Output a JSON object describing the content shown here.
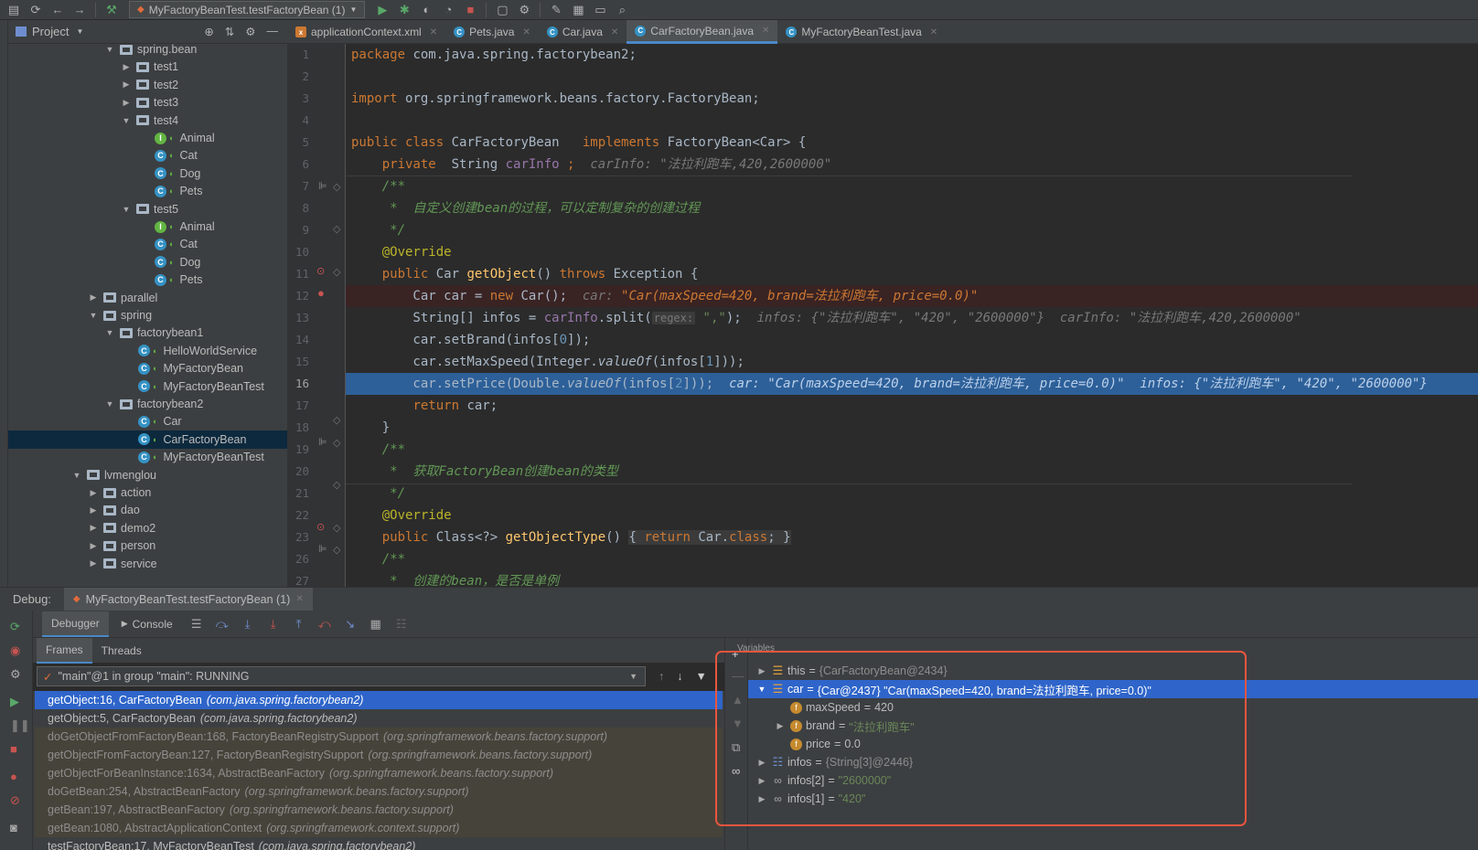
{
  "toolbar": {
    "run_config": "MyFactoryBeanTest.testFactoryBean (1)"
  },
  "project": {
    "title": "Project",
    "tree": [
      {
        "label": "spring.bean",
        "kind": "folder",
        "indent": 6,
        "expanded": true
      },
      {
        "label": "test1",
        "kind": "folder",
        "indent": 7
      },
      {
        "label": "test2",
        "kind": "folder",
        "indent": 7
      },
      {
        "label": "test3",
        "kind": "folder",
        "indent": 7
      },
      {
        "label": "test4",
        "kind": "folder",
        "indent": 7,
        "expanded": true
      },
      {
        "label": "Animal",
        "kind": "interface",
        "indent": 9
      },
      {
        "label": "Cat",
        "kind": "class",
        "indent": 9
      },
      {
        "label": "Dog",
        "kind": "class",
        "indent": 9
      },
      {
        "label": "Pets",
        "kind": "class",
        "indent": 9
      },
      {
        "label": "test5",
        "kind": "folder",
        "indent": 7,
        "expanded": true
      },
      {
        "label": "Animal",
        "kind": "interface",
        "indent": 9
      },
      {
        "label": "Cat",
        "kind": "class",
        "indent": 9
      },
      {
        "label": "Dog",
        "kind": "class",
        "indent": 9
      },
      {
        "label": "Pets",
        "kind": "class",
        "indent": 9
      },
      {
        "label": "parallel",
        "kind": "folder",
        "indent": 5
      },
      {
        "label": "spring",
        "kind": "folder",
        "indent": 5,
        "expanded": true
      },
      {
        "label": "factorybean1",
        "kind": "folder",
        "indent": 6,
        "expanded": true
      },
      {
        "label": "HelloWorldService",
        "kind": "class",
        "indent": 8
      },
      {
        "label": "MyFactoryBean",
        "kind": "class",
        "indent": 8
      },
      {
        "label": "MyFactoryBeanTest",
        "kind": "testclass",
        "indent": 8
      },
      {
        "label": "factorybean2",
        "kind": "folder",
        "indent": 6,
        "expanded": true
      },
      {
        "label": "Car",
        "kind": "class",
        "indent": 8
      },
      {
        "label": "CarFactoryBean",
        "kind": "class",
        "indent": 8,
        "selected": true
      },
      {
        "label": "MyFactoryBeanTest",
        "kind": "testclass",
        "indent": 8
      },
      {
        "label": "lvmenglou",
        "kind": "folder",
        "indent": 4,
        "expanded": true
      },
      {
        "label": "action",
        "kind": "folder",
        "indent": 5
      },
      {
        "label": "dao",
        "kind": "folder",
        "indent": 5
      },
      {
        "label": "demo2",
        "kind": "folder",
        "indent": 5
      },
      {
        "label": "person",
        "kind": "folder",
        "indent": 5
      },
      {
        "label": "service",
        "kind": "folder",
        "indent": 5
      }
    ]
  },
  "editor_tabs": [
    {
      "label": "applicationContext.xml",
      "icon": "xml",
      "active": false
    },
    {
      "label": "Pets.java",
      "icon": "class",
      "active": false
    },
    {
      "label": "Car.java",
      "icon": "class",
      "active": false
    },
    {
      "label": "CarFactoryBean.java",
      "icon": "class",
      "active": true
    },
    {
      "label": "MyFactoryBeanTest.java",
      "icon": "class",
      "active": false
    }
  ],
  "editor": {
    "line_numbers": [
      "1",
      "2",
      "3",
      "4",
      "5",
      "6",
      "7",
      "8",
      "9",
      "10",
      "11",
      "12",
      "13",
      "14",
      "15",
      "16",
      "17",
      "18",
      "19",
      "20",
      "21",
      "22",
      "23",
      "26",
      "27"
    ],
    "current_line": "16"
  },
  "debug": {
    "label": "Debug:",
    "session": "MyFactoryBeanTest.testFactoryBean (1)",
    "tabs": [
      "Debugger",
      "Console"
    ],
    "subtabs": [
      "Frames",
      "Threads"
    ],
    "thread": "\"main\"@1 in group \"main\": RUNNING",
    "frames": [
      {
        "method": "getObject:16, CarFactoryBean",
        "pkg": "(com.java.spring.factorybean2)",
        "state": "sel"
      },
      {
        "method": "getObject:5, CarFactoryBean",
        "pkg": "(com.java.spring.factorybean2)",
        "state": "normal"
      },
      {
        "method": "doGetObjectFromFactoryBean:168, FactoryBeanRegistrySupport",
        "pkg": "(org.springframework.beans.factory.support)",
        "state": "lib"
      },
      {
        "method": "getObjectFromFactoryBean:127, FactoryBeanRegistrySupport",
        "pkg": "(org.springframework.beans.factory.support)",
        "state": "lib"
      },
      {
        "method": "getObjectForBeanInstance:1634, AbstractBeanFactory",
        "pkg": "(org.springframework.beans.factory.support)",
        "state": "lib"
      },
      {
        "method": "doGetBean:254, AbstractBeanFactory",
        "pkg": "(org.springframework.beans.factory.support)",
        "state": "lib"
      },
      {
        "method": "getBean:197, AbstractBeanFactory",
        "pkg": "(org.springframework.beans.factory.support)",
        "state": "lib"
      },
      {
        "method": "getBean:1080, AbstractApplicationContext",
        "pkg": "(org.springframework.context.support)",
        "state": "lib"
      },
      {
        "method": "testFactoryBean:17, MyFactoryBeanTest",
        "pkg": "(com.java.spring.factorybean2)",
        "state": "normal"
      }
    ],
    "variables_title": "Variables",
    "variables": [
      {
        "name": "this",
        "value": "{CarFactoryBean@2434}",
        "icon": "obj",
        "indent": 0,
        "expand": "▶",
        "vtype": "ref"
      },
      {
        "name": "car",
        "value": "{Car@2437} \"Car(maxSpeed=420, brand=法拉利跑车, price=0.0)\"",
        "icon": "obj",
        "indent": 0,
        "expand": "▼",
        "vtype": "ref",
        "selected": true
      },
      {
        "name": "maxSpeed",
        "value": "420",
        "icon": "fld",
        "indent": 1,
        "expand": "",
        "vtype": "plain"
      },
      {
        "name": "brand",
        "value": "\"法拉利跑车\"",
        "icon": "fld",
        "indent": 1,
        "expand": "▶",
        "vtype": "s"
      },
      {
        "name": "price",
        "value": "0.0",
        "icon": "fld",
        "indent": 1,
        "expand": "",
        "vtype": "plain"
      },
      {
        "name": "infos",
        "value": "{String[3]@2446}",
        "icon": "arr",
        "indent": 0,
        "expand": "▶",
        "vtype": "ref"
      },
      {
        "name": "infos[2]",
        "value": "\"2600000\"",
        "icon": "wat",
        "indent": 0,
        "expand": "▶",
        "vtype": "s"
      },
      {
        "name": "infos[1]",
        "value": "\"420\"",
        "icon": "wat",
        "indent": 0,
        "expand": "▶",
        "vtype": "s"
      }
    ]
  },
  "colors": {
    "accent": "#2f65ca",
    "highlight_box": "#e8553f",
    "exec_line": "#2d6099"
  }
}
